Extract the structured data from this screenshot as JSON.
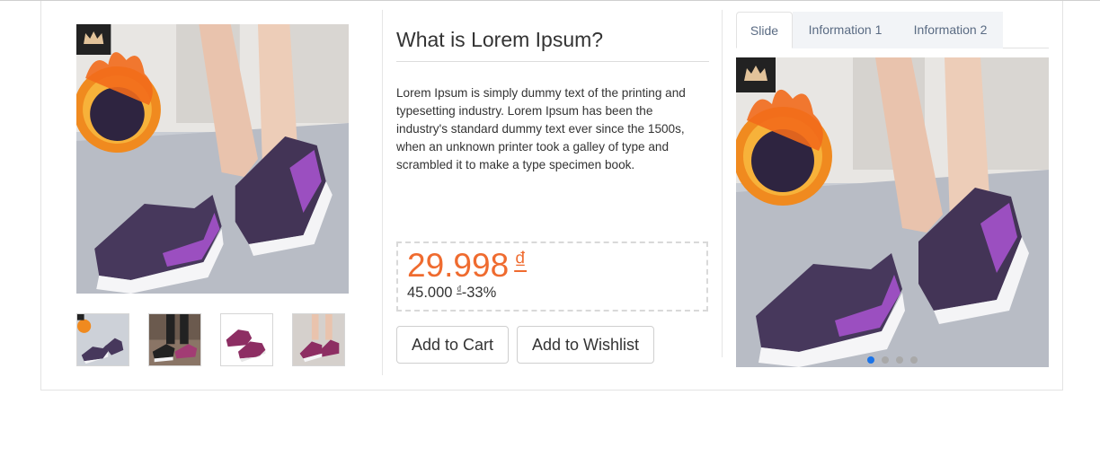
{
  "product": {
    "title": "What is Lorem Ipsum?",
    "description": "Lorem Ipsum is simply dummy text of the printing and typesetting industry. Lorem Ipsum has been the industry's standard dummy text ever since the 1500s, when an unknown printer took a galley of type and scrambled it to make a type specimen book.",
    "price": "29.998",
    "currency": "₫",
    "old_price": "45.000",
    "discount": "-33%"
  },
  "actions": {
    "add_to_cart": "Add to Cart",
    "add_to_wishlist": "Add to Wishlist"
  },
  "tabs": [
    {
      "label": "Slide",
      "active": true
    },
    {
      "label": "Information 1",
      "active": false
    },
    {
      "label": "Information 2",
      "active": false
    }
  ],
  "slider": {
    "slide_count": 4,
    "active_index": 0
  },
  "colors": {
    "price": "#ef6b2f",
    "active_dot": "#1a73e8",
    "shoe": "#4b3a66",
    "accent": "#9b4fc0"
  },
  "icons": [
    "crown-icon",
    "flame-icon"
  ]
}
